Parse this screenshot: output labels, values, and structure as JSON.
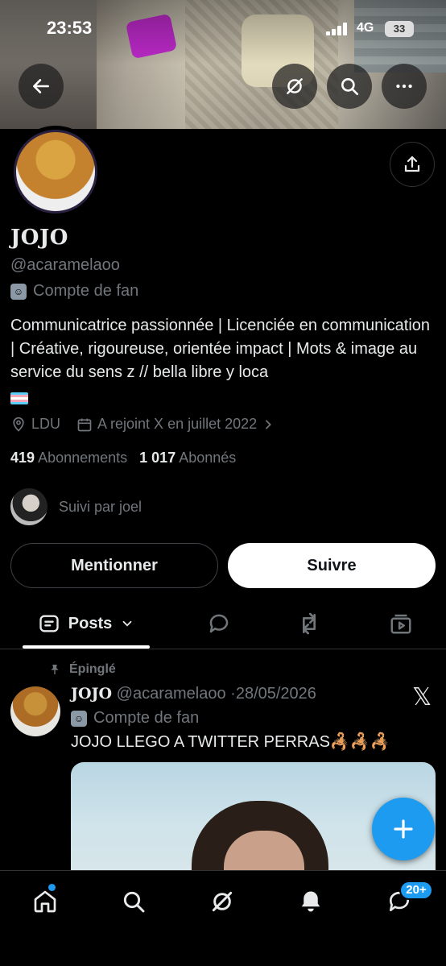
{
  "status_bar": {
    "time": "23:53",
    "network": "4G",
    "battery": "33"
  },
  "profile": {
    "name": "JOJO",
    "handle": "@acaramelaoo",
    "label": "Compte de fan",
    "bio": "Communicatrice passionnée | Licenciée en communication | Créative, rigoureuse, orientée impact | Mots & image au service du sens z // bella libre y loca",
    "location": "LDU",
    "joined": "A rejoint X en juillet 2022",
    "following_count": "419",
    "following_label": "Abonnements",
    "followers_count": "1 017",
    "followers_label": "Abonnés",
    "followed_by": "Suivi par joel"
  },
  "actions": {
    "mention": "Mentionner",
    "follow": "Suivre"
  },
  "tabs": {
    "posts": "Posts"
  },
  "post": {
    "pinned_label": "Épinglé",
    "author_name": "JOJO",
    "author_handle": "@acaramelaoo",
    "separator": "·",
    "date": "28/05/2026",
    "author_label": "Compte de fan",
    "text": "JOJO LLEGO A TWITTER PERRAS🦂🦂🦂"
  },
  "bottom_nav": {
    "messages_badge": "20+"
  },
  "colors": {
    "accent": "#1d9bf0",
    "background": "#000000",
    "muted_text": "#71767b"
  }
}
